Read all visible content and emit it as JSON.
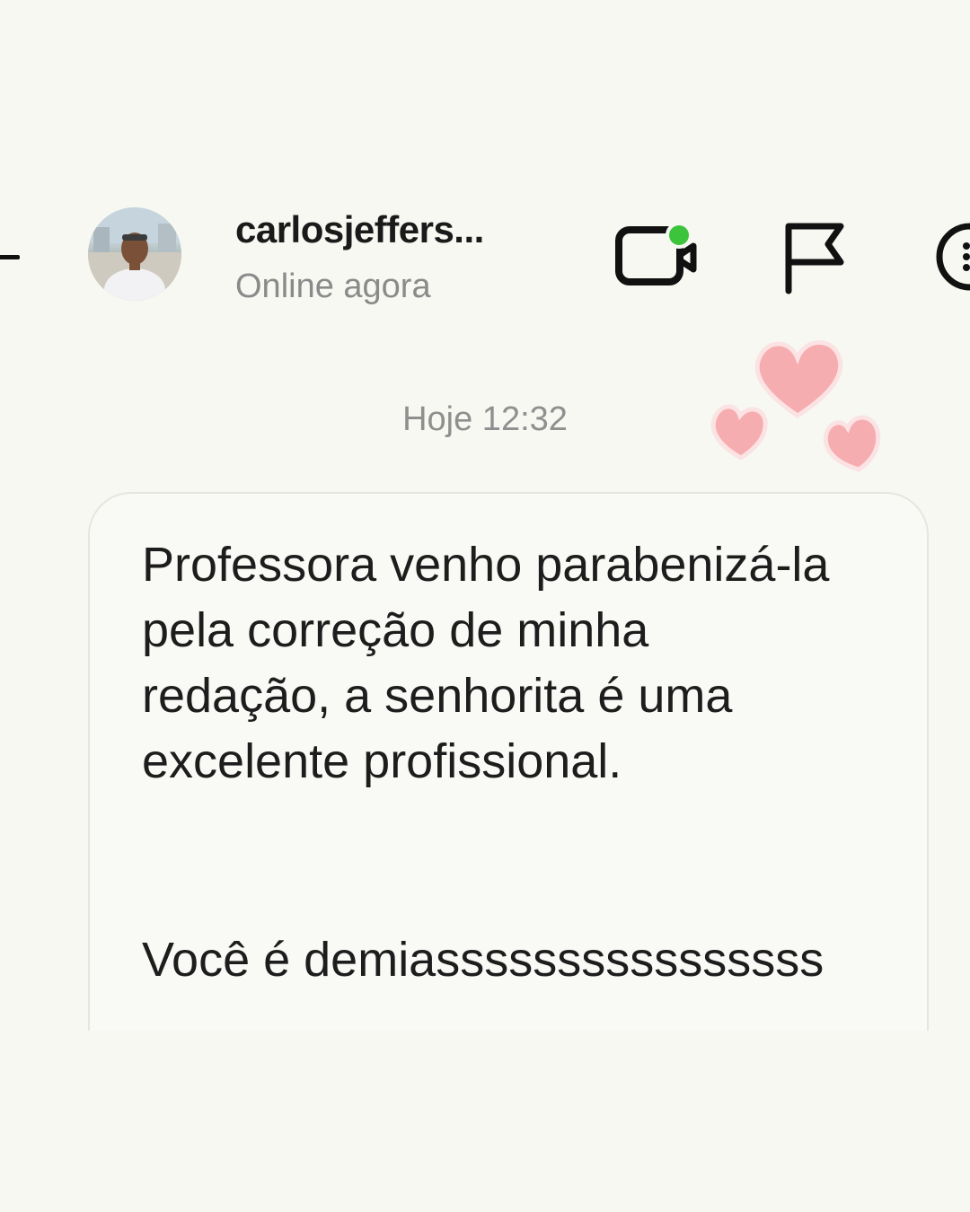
{
  "header": {
    "username": "carlosjeffers...",
    "status": "Online agora",
    "icons": {
      "back": "back-arrow-icon",
      "video": "video-call-icon",
      "flag": "flag-icon",
      "more": "more-options-icon"
    },
    "online_dot_color": "#3cc43c"
  },
  "decoration": {
    "hearts_color": "#f4a3a6"
  },
  "conversation": {
    "timestamp": "Hoje 12:32",
    "message": {
      "lines": [
        "Professora venho parabenizá-la",
        "pela correção de minha",
        "redação, a senhorita é uma",
        "excelente profissional.",
        "Você é demiassssssssssssssss"
      ]
    }
  }
}
